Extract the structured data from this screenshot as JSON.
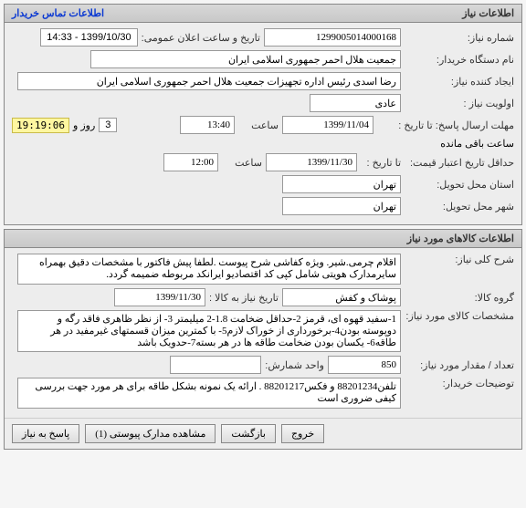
{
  "panel1": {
    "title": "اطلاعات نیاز",
    "contact_link": "اطلاعات تماس خریدار",
    "need_no_label": "شماره نیاز:",
    "need_no": "1299005014000168",
    "announce_label": "تاریخ و ساعت اعلان عمومی:",
    "announce_value": "1399/10/30 - 14:33",
    "buyer_org_label": "نام دستگاه خریدار:",
    "buyer_org": "جمعیت هلال احمر جمهوری اسلامی ایران",
    "creator_label": "ایجاد کننده نیاز:",
    "creator": "رضا اسدی رئیس اداره تجهیزات جمعیت هلال احمر جمهوری اسلامی ایران",
    "priority_label": "اولویت نیاز :",
    "priority": "عادی",
    "deadline_label": "مهلت ارسال پاسخ:  تا تاریخ :",
    "deadline_date": "1399/11/04",
    "time_word": "ساعت",
    "deadline_time": "13:40",
    "remain_days": "3",
    "day_and_word": "روز و",
    "remain_timer": "19:19:06",
    "remain_suffix": "ساعت باقی مانده",
    "credit_label": "حداقل تاریخ اعتبار قیمت:",
    "credit_until": "تا تاریخ :",
    "credit_date": "1399/11/30",
    "credit_time": "12:00",
    "deliver_state_label": "استان محل تحویل:",
    "deliver_state": "تهران",
    "deliver_city_label": "شهر محل تحویل:",
    "deliver_city": "تهران"
  },
  "panel2": {
    "title": "اطلاعات کالاهای مورد نیاز",
    "desc_label": "شرح کلی نیاز:",
    "desc": "اقلام چرمی.شیر. ویژه کفاشی شرح پیوست .لطفا پیش فاکتور با مشخصات دقیق بهمراه سایرمدارک هویتی شامل کپی کد اقتصادیو ایرانکد مربوطه ضمیمه گردد.",
    "group_label": "گروه کالا:",
    "group": "پوشاک و کفش",
    "item_date_label": "تاریخ نیاز به کالا :",
    "item_date": "1399/11/30",
    "spec_label": "مشخصات کالای مورد نیاز:",
    "spec": "1-سفید قهوه ای، قرمز 2-حداقل ضخامت 1.8-2 میلیمتر 3- از نظر ظاهری فاقد رگه و دوپوسته بودن4-برخورداری از خوراک لازم5- با کمترین میزان قسمتهای غیرمفید در هر طاقه6- یکسان بودن ضخامت طاقه ها در هر بسته7-حدویک باشد",
    "qty_label": "تعداد / مقدار مورد نیاز:",
    "qty": "850",
    "unit_label": "واحد شمارش:",
    "unit": "",
    "notes_label": "توضیحات خریدار:",
    "notes": "تلفن88201234 و فکس88201217 . ارائه یک نمونه بشکل طاقه برای هر مورد جهت بررسی کیفی ضروری است"
  },
  "buttons": {
    "reply": "پاسخ به نیاز",
    "attachments": "مشاهده مدارک پیوستی",
    "attachments_count": "(1)",
    "back": "بازگشت",
    "exit": "خروج"
  }
}
